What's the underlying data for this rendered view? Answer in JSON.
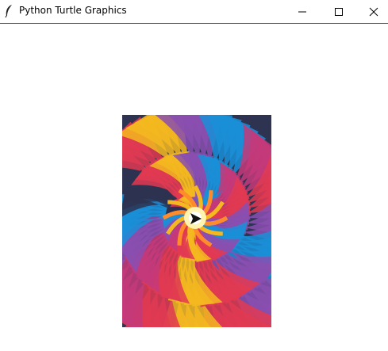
{
  "window": {
    "title": "Python Turtle Graphics",
    "app_icon": "feather-icon",
    "controls": {
      "minimize_icon": "minimize-icon",
      "maximize_icon": "maximize-icon",
      "close_icon": "close-icon"
    }
  },
  "canvas": {
    "background": "#ffffff",
    "artwork": {
      "palette": [
        "#e23a52",
        "#f5b820",
        "#1a8fd8",
        "#8a4fb0",
        "#2d3350",
        "#c43a7a"
      ],
      "turtle_icon": "turtle-arrow-icon"
    }
  }
}
